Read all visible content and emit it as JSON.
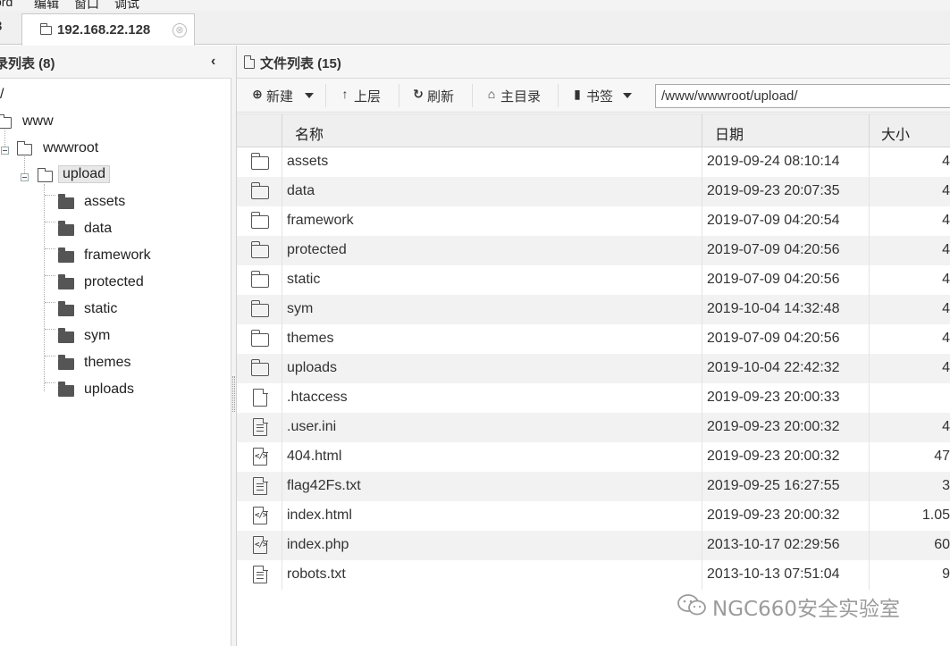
{
  "menubar": {
    "items": [
      "ord",
      "编辑",
      "窗口",
      "调试"
    ]
  },
  "tabs": {
    "prev_partial": "3",
    "active": {
      "label": "192.168.22.128",
      "close": "⊗"
    }
  },
  "left_panel": {
    "title": "录列表 (8)",
    "collapse_icon": "‹",
    "tree": {
      "root": "/",
      "www": "www",
      "wwwroot": "wwwroot",
      "upload": "upload",
      "children": [
        "assets",
        "data",
        "framework",
        "protected",
        "static",
        "sym",
        "themes",
        "uploads"
      ]
    }
  },
  "right_panel": {
    "title": "文件列表 (15)",
    "toolbar": {
      "new_label": "新建",
      "up_label": "上层",
      "refresh_label": "刷新",
      "home_label": "主目录",
      "bookmark_label": "书签",
      "path_value": "/www/wwwroot/upload/"
    },
    "columns": {
      "name": "名称",
      "date": "日期",
      "size": "大小"
    },
    "files": [
      {
        "name": "assets",
        "date": "2019-09-24 08:10:14",
        "size": "4",
        "icon": "folder-icon"
      },
      {
        "name": "data",
        "date": "2019-09-23 20:07:35",
        "size": "4",
        "icon": "folder-icon"
      },
      {
        "name": "framework",
        "date": "2019-07-09 04:20:54",
        "size": "4",
        "icon": "folder-icon"
      },
      {
        "name": "protected",
        "date": "2019-07-09 04:20:56",
        "size": "4",
        "icon": "folder-icon"
      },
      {
        "name": "static",
        "date": "2019-07-09 04:20:56",
        "size": "4",
        "icon": "folder-icon"
      },
      {
        "name": "sym",
        "date": "2019-10-04 14:32:48",
        "size": "4",
        "icon": "folder-icon"
      },
      {
        "name": "themes",
        "date": "2019-07-09 04:20:56",
        "size": "4",
        "icon": "folder-icon"
      },
      {
        "name": "uploads",
        "date": "2019-10-04 22:42:32",
        "size": "4",
        "icon": "folder-icon"
      },
      {
        "name": ".htaccess",
        "date": "2019-09-23 20:00:33",
        "size": "",
        "icon": "blank-file-icon"
      },
      {
        "name": ".user.ini",
        "date": "2019-09-23 20:00:32",
        "size": "4",
        "icon": "text-file-icon"
      },
      {
        "name": "404.html",
        "date": "2019-09-23 20:00:32",
        "size": "47",
        "icon": "code-file-icon"
      },
      {
        "name": "flag42Fs.txt",
        "date": "2019-09-25 16:27:55",
        "size": "3",
        "icon": "text-file-icon"
      },
      {
        "name": "index.html",
        "date": "2019-09-23 20:00:32",
        "size": "1.05",
        "icon": "code-file-icon"
      },
      {
        "name": "index.php",
        "date": "2013-10-17 02:29:56",
        "size": "60",
        "icon": "code-file-icon"
      },
      {
        "name": "robots.txt",
        "date": "2013-10-13 07:51:04",
        "size": "9",
        "icon": "text-file-icon"
      }
    ]
  },
  "watermark": {
    "text": "NGC660安全实验室",
    "logo": "wechat-logo"
  }
}
